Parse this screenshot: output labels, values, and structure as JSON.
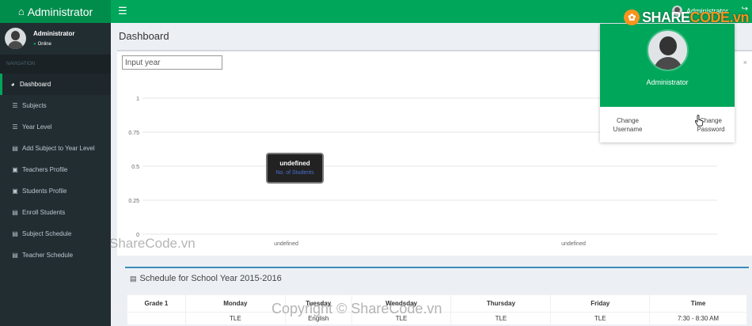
{
  "brand": {
    "title": "Administrator"
  },
  "topbar": {
    "user_name": "Administrator"
  },
  "sidebar": {
    "user_name": "Administrator",
    "status": "Online",
    "nav_header": "NAVIGATION",
    "items": [
      {
        "label": "Dashboard",
        "icon": "dashboard-icon",
        "active": true
      },
      {
        "label": "Subjects",
        "icon": "list-icon"
      },
      {
        "label": "Year Level",
        "icon": "list-icon"
      },
      {
        "label": "Add Subject to Year Level",
        "icon": "file-icon"
      },
      {
        "label": "Teachers Profile",
        "icon": "folder-icon"
      },
      {
        "label": "Students Profile",
        "icon": "folder-icon"
      },
      {
        "label": "Enroll Students",
        "icon": "file-icon"
      },
      {
        "label": "Subject Schedule",
        "icon": "file-icon"
      },
      {
        "label": "Teacher Schedule",
        "icon": "file-icon"
      }
    ]
  },
  "main": {
    "page_title": "Dashboard",
    "year_input_placeholder": "Input year"
  },
  "chart_data": {
    "type": "line",
    "categories": [
      "undefined",
      "undefined"
    ],
    "y_ticks": [
      "1",
      "0.75",
      "0.5",
      "0.25",
      "0"
    ],
    "ylim": [
      0,
      1
    ],
    "grid": true,
    "tooltip": {
      "title": "undefined",
      "label": "No. of Students"
    }
  },
  "schedule": {
    "title": "Schedule for School Year 2015-2016",
    "headers": [
      "Grade 1",
      "Monday",
      "Tuesday",
      "Wendsday",
      "Thursday",
      "Friday",
      "Time"
    ],
    "rows": [
      [
        "",
        "TLE",
        "English",
        "TLE",
        "TLE",
        "TLE",
        "7:30 - 8:30 AM"
      ]
    ]
  },
  "dropdown": {
    "user_name": "Administrator",
    "change_username": "Change Username",
    "change_password": "Change Password"
  },
  "watermarks": {
    "logo_text_a": "SHARE",
    "logo_text_b": "CODE.vn",
    "text_1": "ShareCode.vn",
    "text_2": "Copyright © ShareCode.vn"
  },
  "colors": {
    "header_green": "#00a65a",
    "logo_green": "#008d4c",
    "sidebar_bg": "#222d32",
    "schedule_accent": "#3c8dbc"
  }
}
